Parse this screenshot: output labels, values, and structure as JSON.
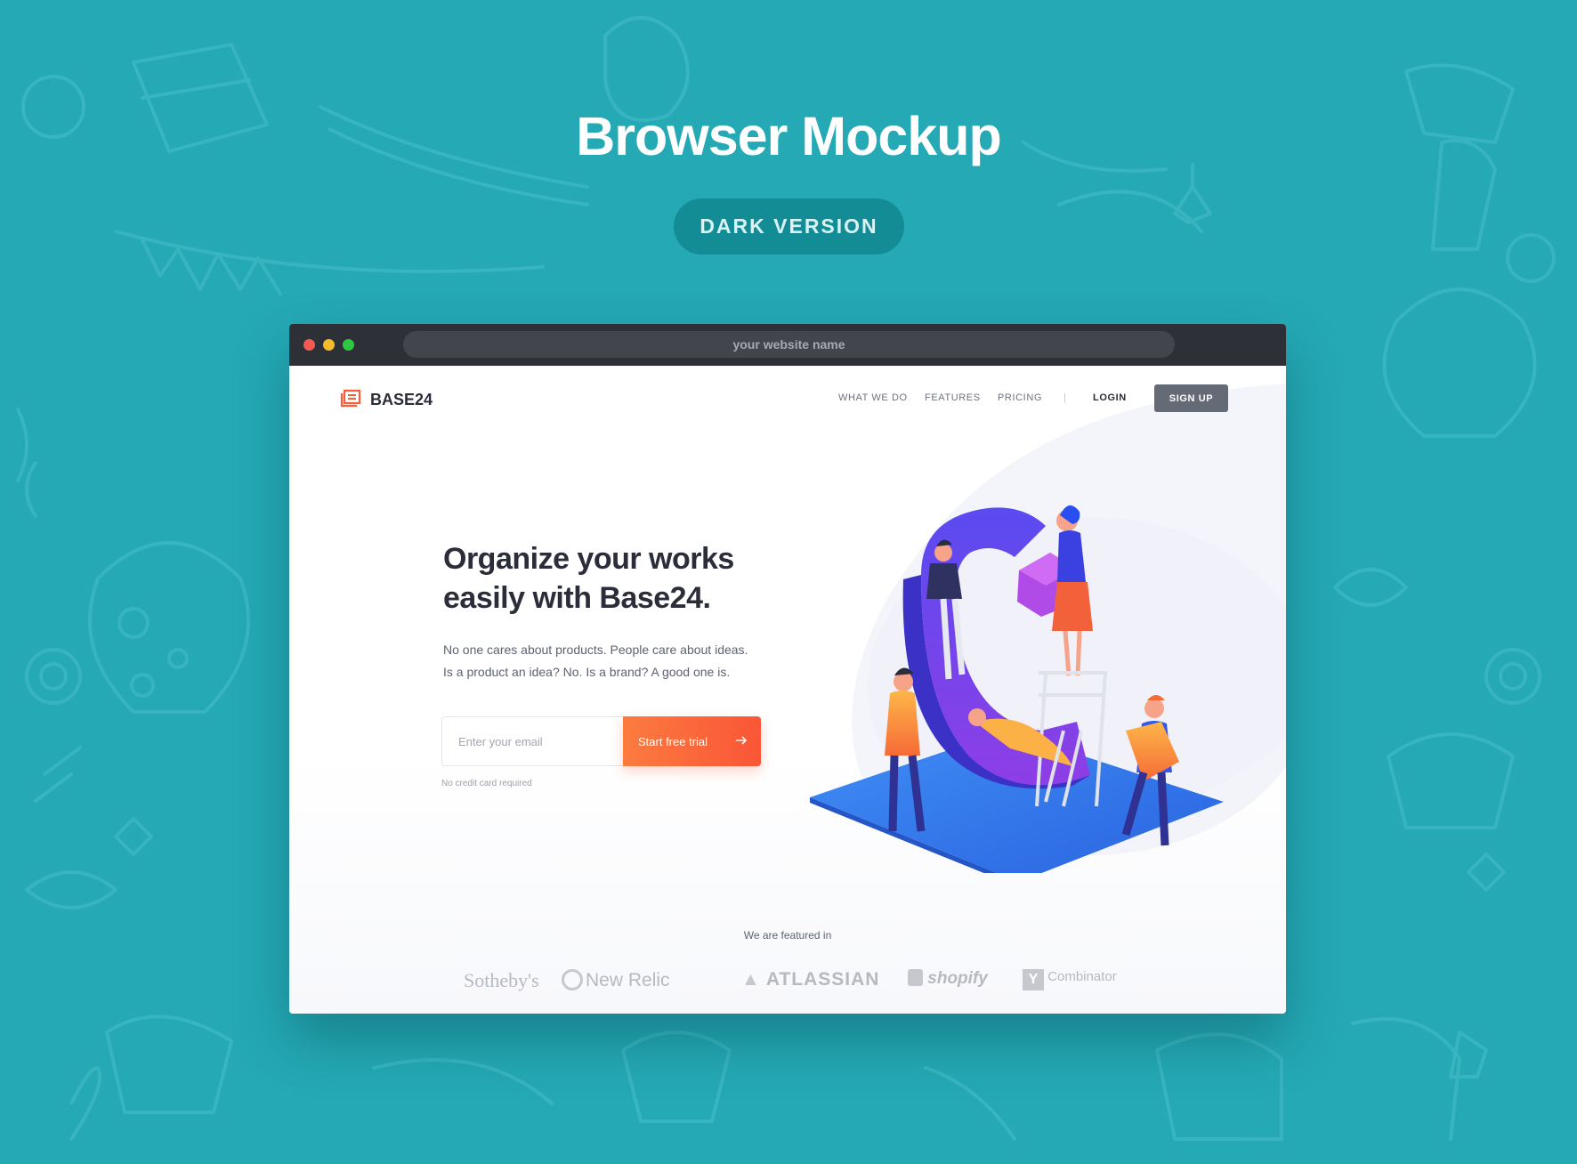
{
  "promo": {
    "title": "Browser Mockup",
    "badge": "DARK VERSION"
  },
  "browser": {
    "address": "your website name"
  },
  "site": {
    "logo_text": "BASE24",
    "nav": {
      "what_we_do": "WHAT WE DO",
      "features": "FEATURES",
      "pricing": "PRICING",
      "separator": "|",
      "login": "LOGIN",
      "signup": "SIGN UP"
    },
    "hero": {
      "headline_line1": "Organize your works",
      "headline_line2": "easily with Base24.",
      "sub_line1": "No one cares about products. People care about ideas.",
      "sub_line2": "Is a product an idea? No. Is a brand? A good one is."
    },
    "form": {
      "email_placeholder": "Enter your email",
      "cta": "Start free trial",
      "note": "No credit card required"
    },
    "featured": {
      "label": "We are featured in",
      "brands": [
        "Sotheby's",
        "New Relic",
        "ATLASSIAN",
        "shopify",
        "Combinator"
      ]
    }
  },
  "colors": {
    "background": "#24a9b5",
    "badge": "#138c95",
    "chrome": "#2e3038",
    "accent": "#fa5e38",
    "signup": "#656a77",
    "traffic_red": "#f25a52",
    "traffic_yellow": "#f6bb2b",
    "traffic_green": "#2ec840"
  },
  "icons": {
    "logo": "document-stack-icon",
    "cta_arrow": "arrow-right-icon"
  }
}
